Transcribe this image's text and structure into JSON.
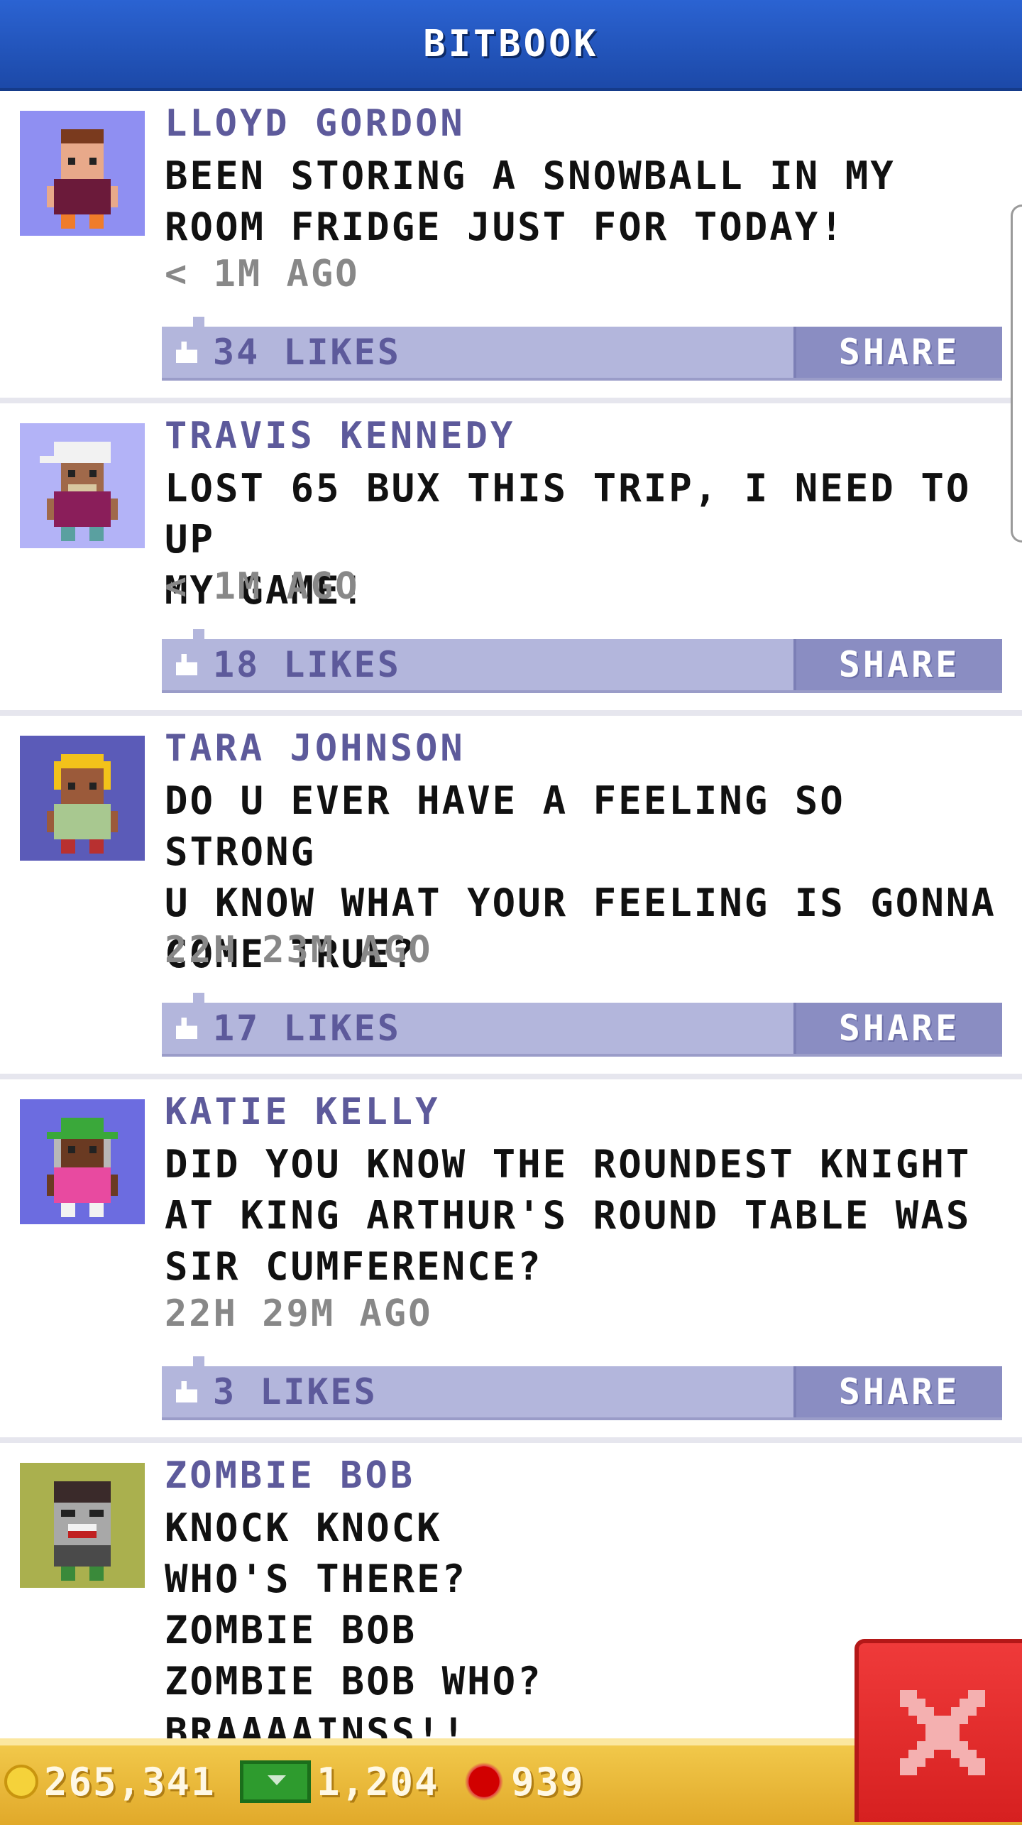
{
  "header": {
    "title": "BITBOOK"
  },
  "posts": [
    {
      "name": "LLOYD GORDON",
      "message": "BEEN STORING A SNOWBALL IN MY\nROOM FRIDGE JUST FOR TODAY!",
      "time": "< 1M AGO",
      "likes": "34 LIKES",
      "share": "SHARE",
      "avatar_bg": "#8f8ff2"
    },
    {
      "name": "TRAVIS KENNEDY",
      "message": "LOST 65 BUX THIS TRIP, I NEED TO UP\nMY GAME!",
      "time": "< 1M AGO",
      "likes": "18 LIKES",
      "share": "SHARE",
      "avatar_bg": "#b3b3f7"
    },
    {
      "name": "TARA JOHNSON",
      "message": "DO U EVER HAVE A FEELING SO STRONG\nU KNOW WHAT YOUR FEELING IS GONNA\nCOME TRUE?",
      "time": "22H 23M AGO",
      "likes": "17 LIKES",
      "share": "SHARE",
      "avatar_bg": "#5b5bb8"
    },
    {
      "name": "KATIE KELLY",
      "message": "DID YOU KNOW THE ROUNDEST KNIGHT\nAT KING ARTHUR'S ROUND TABLE WAS\nSIR CUMFERENCE?",
      "time": "22H 29M AGO",
      "likes": "3 LIKES",
      "share": "SHARE",
      "avatar_bg": "#6c6ce0"
    },
    {
      "name": "ZOMBIE BOB",
      "message": "KNOCK KNOCK\nWHO'S THERE?\nZOMBIE BOB\nZOMBIE BOB WHO?\nBRAAAAINSS!!",
      "avatar_bg": "#aab04e"
    }
  ],
  "footer": {
    "coins": "265,341",
    "bux": "1,204",
    "gems": "939"
  },
  "icons": {
    "like": "thumbs-up-icon",
    "coin": "coin-icon",
    "bux": "cash-icon",
    "gem": "gem-icon",
    "close": "close-icon"
  },
  "colors": {
    "header": "#2358c4",
    "like_bar": "#b3b6dc",
    "share": "#8a8dc2",
    "name": "#5d5a9b",
    "footer": "#e9b934",
    "close": "#e02a2a"
  }
}
